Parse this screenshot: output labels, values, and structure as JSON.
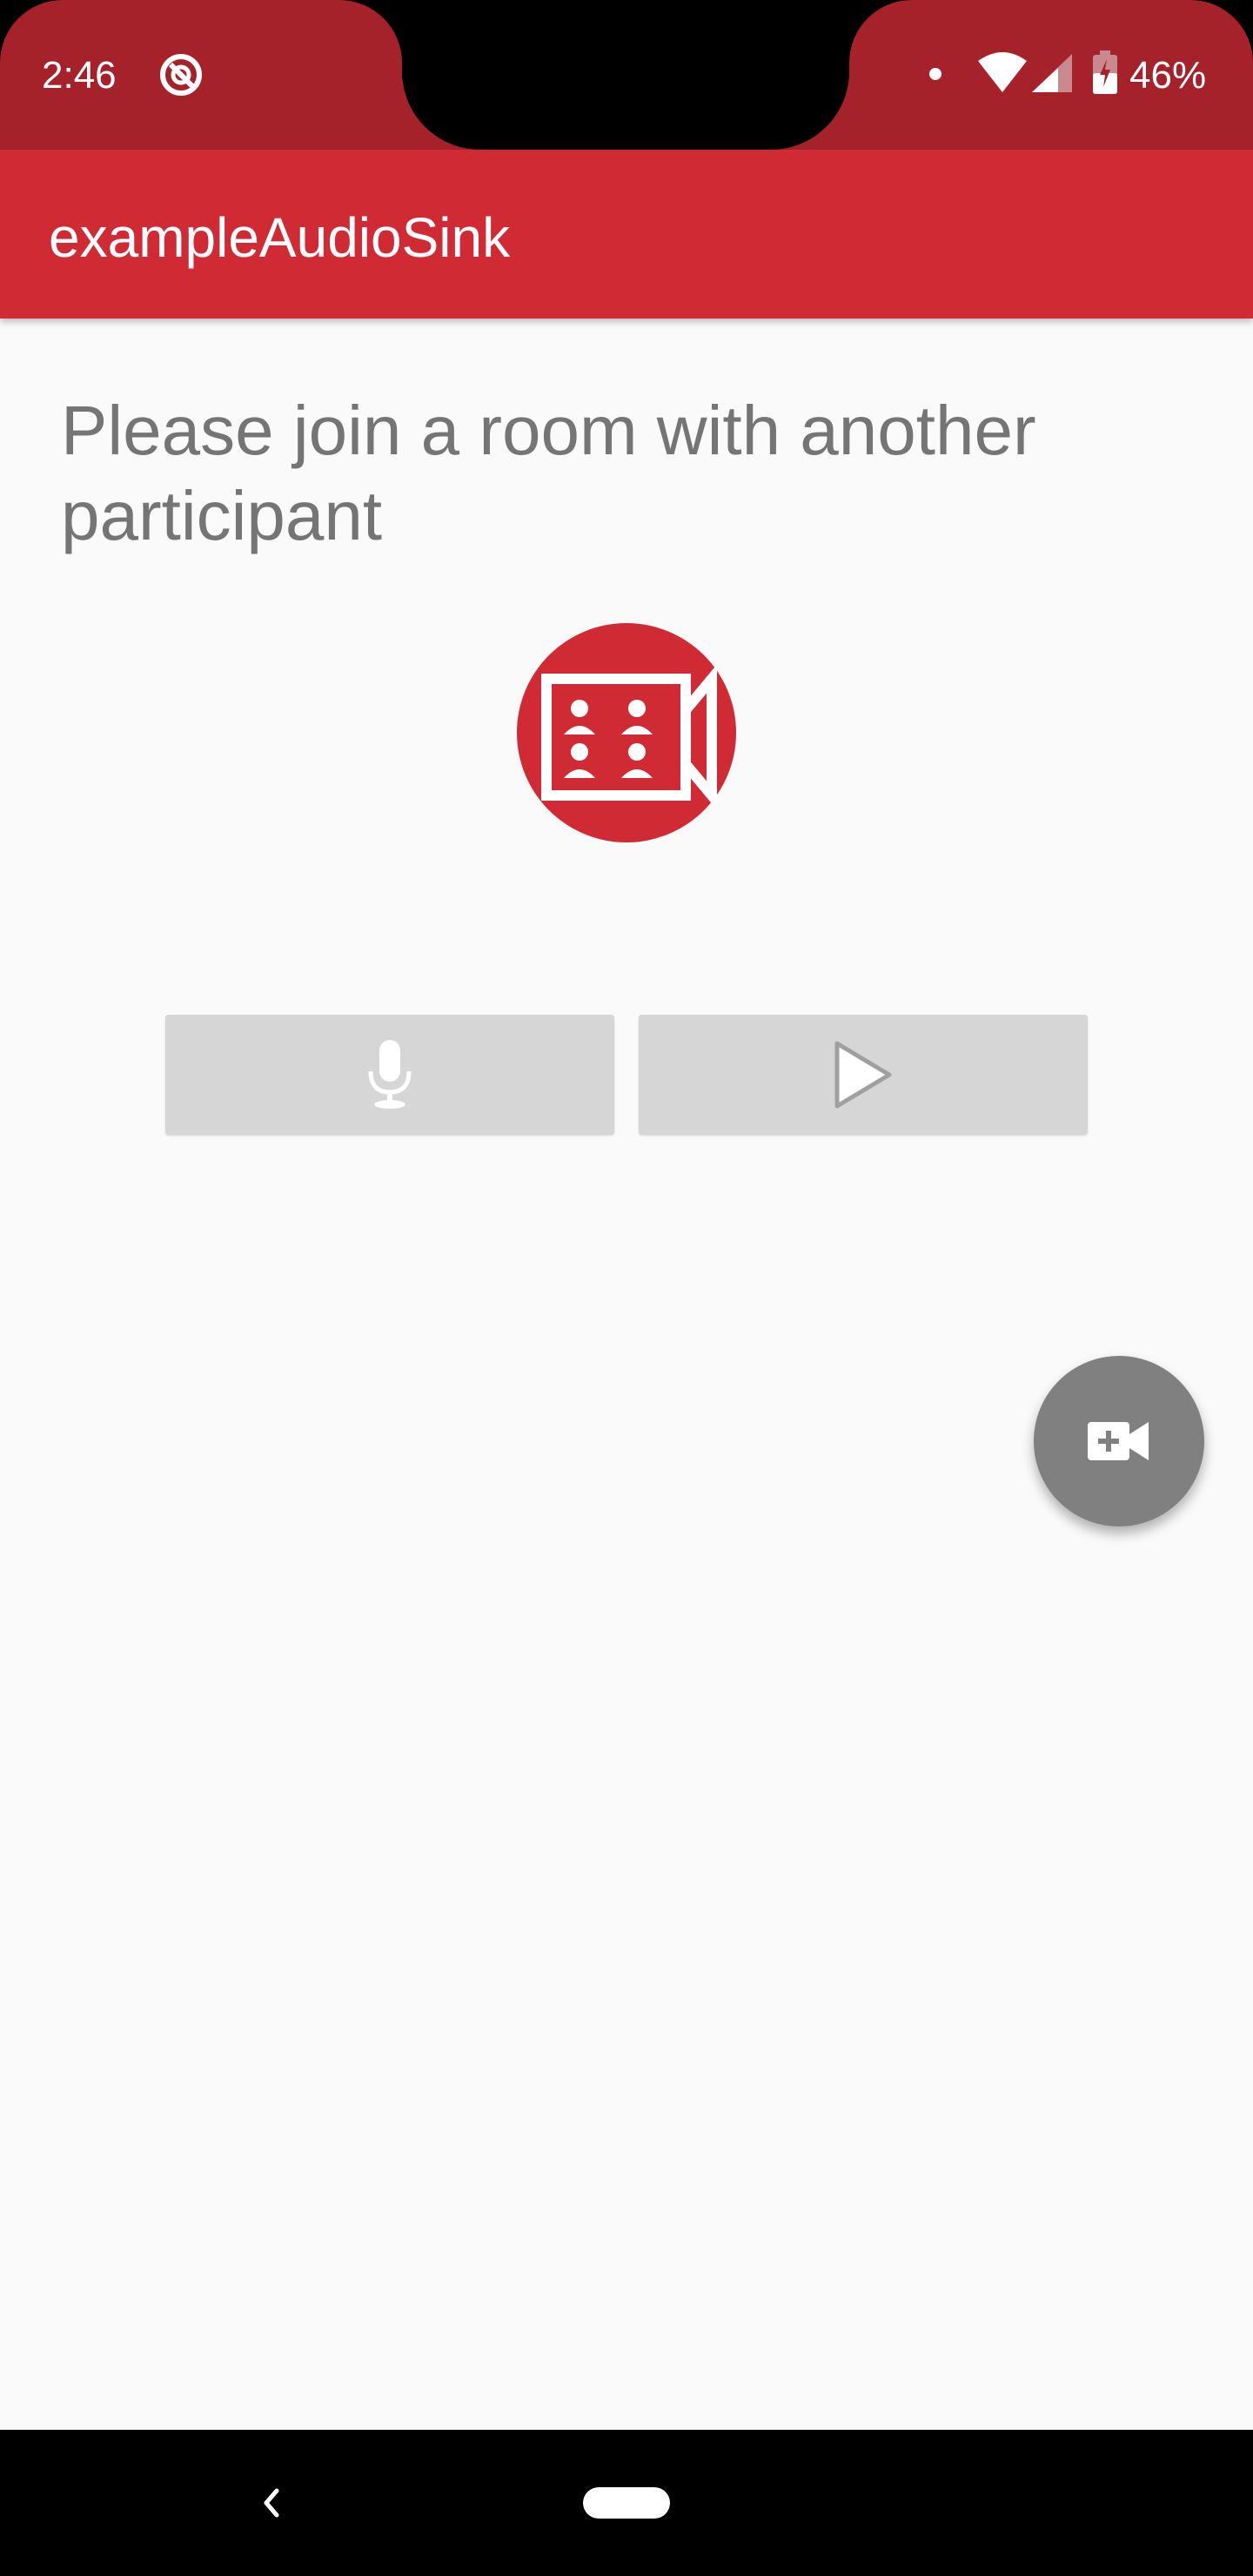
{
  "status_bar": {
    "time": "2:46",
    "battery_percent": "46%",
    "icons": [
      "do-not-disturb-icon",
      "notification-dot-icon",
      "wifi-icon",
      "cell-signal-icon",
      "battery-charging-icon"
    ]
  },
  "app_bar": {
    "title": "exampleAudioSink",
    "color": "#d02b35"
  },
  "main": {
    "prompt": "Please join a room with another participant",
    "logo_icon": "video-room-icon",
    "buttons": [
      {
        "name": "microphone",
        "icon": "microphone-icon"
      },
      {
        "name": "play",
        "icon": "play-icon"
      }
    ],
    "fab_icon": "video-call-add-icon"
  },
  "nav_bar": {
    "icons": [
      "back-icon",
      "home-pill-icon"
    ]
  },
  "colors": {
    "accent": "#d02b35",
    "status_bar": "#a6222b",
    "background": "#fafafa",
    "button_disabled": "#d6d6d6",
    "fab": "#808080"
  }
}
